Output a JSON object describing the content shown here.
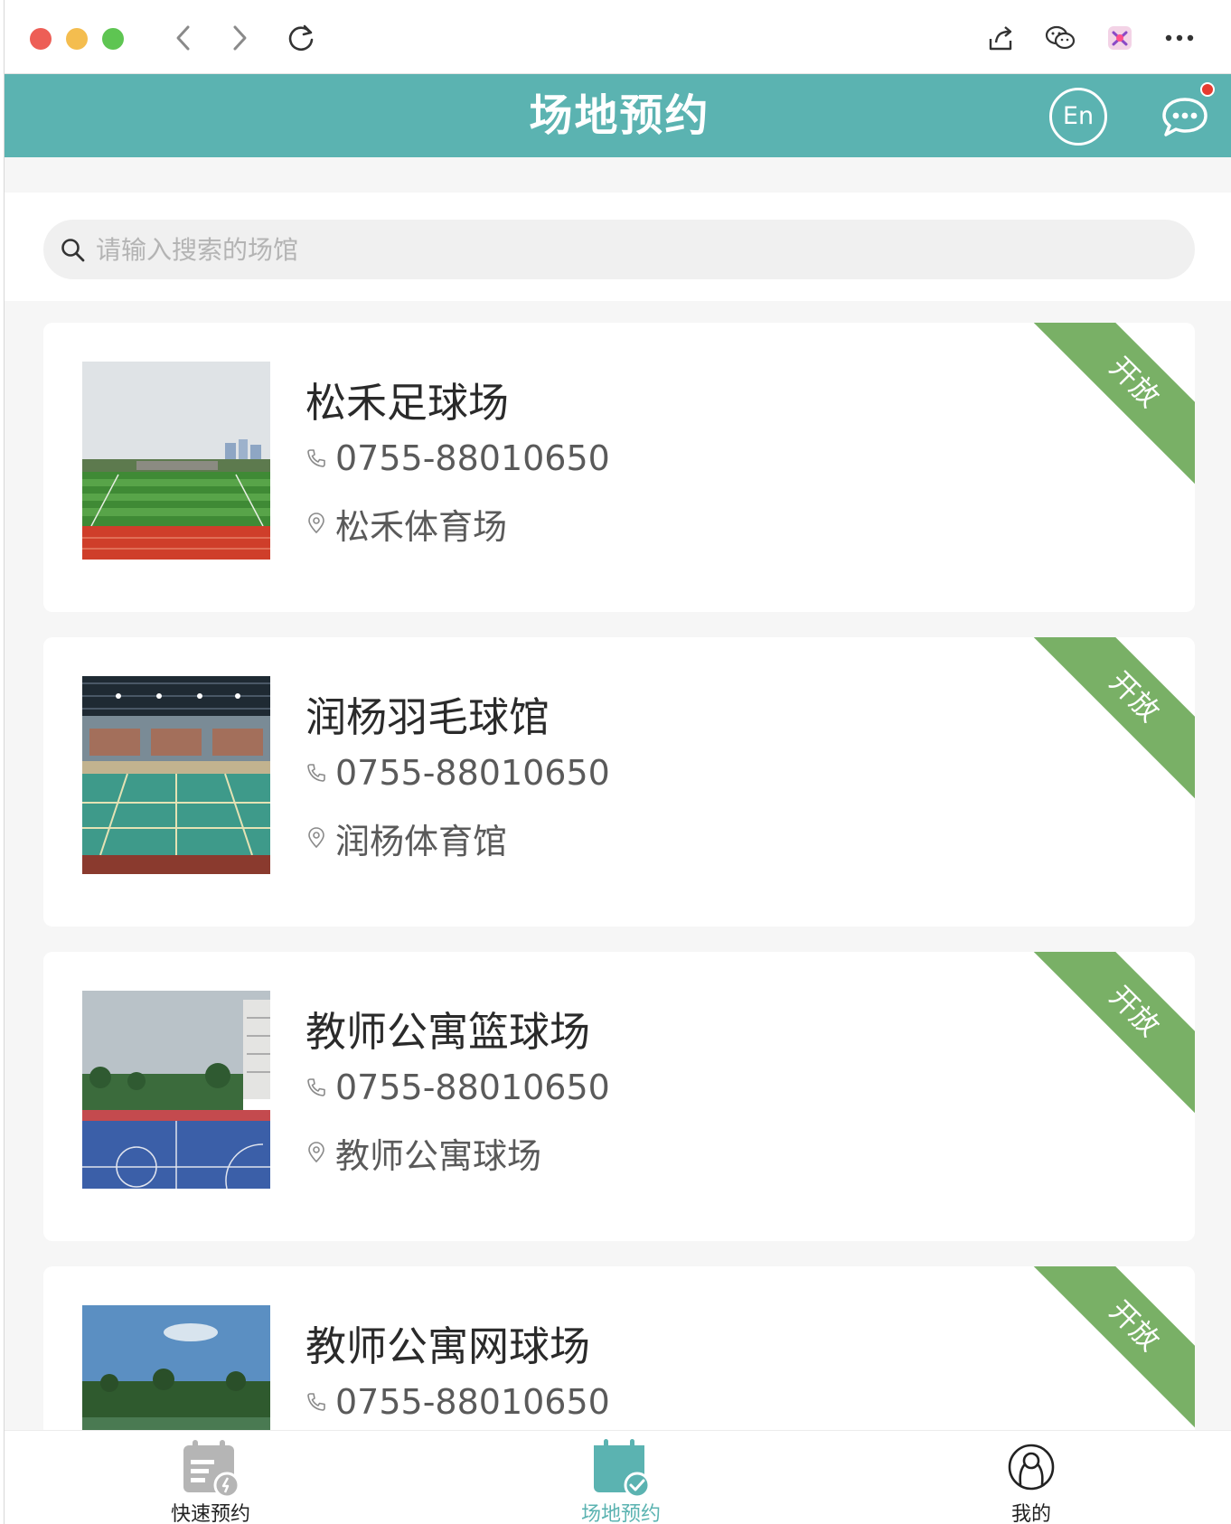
{
  "header": {
    "title": "场地预约",
    "lang_label": "En"
  },
  "search": {
    "placeholder": "请输入搜索的场馆",
    "value": ""
  },
  "venues": [
    {
      "name": "松禾足球场",
      "phone": "0755-88010650",
      "location": "松禾体育场",
      "status": "开放",
      "thumb": "soccer-field"
    },
    {
      "name": "润杨羽毛球馆",
      "phone": "0755-88010650",
      "location": "润杨体育馆",
      "status": "开放",
      "thumb": "badminton-hall"
    },
    {
      "name": "教师公寓篮球场",
      "phone": "0755-88010650",
      "location": "教师公寓球场",
      "status": "开放",
      "thumb": "basketball-court"
    },
    {
      "name": "教师公寓网球场",
      "phone": "0755-88010650",
      "location": "",
      "status": "开放",
      "thumb": "tennis-court"
    }
  ],
  "nav": {
    "items": [
      {
        "label": "快速预约",
        "icon": "calendar-list-icon",
        "active": false
      },
      {
        "label": "场地预约",
        "icon": "calendar-check-icon",
        "active": true
      },
      {
        "label": "我的",
        "icon": "user-icon",
        "active": false
      }
    ]
  },
  "colors": {
    "primary": "#5bb3b1",
    "ribbon": "#79b066",
    "badge": "#e63b30"
  }
}
